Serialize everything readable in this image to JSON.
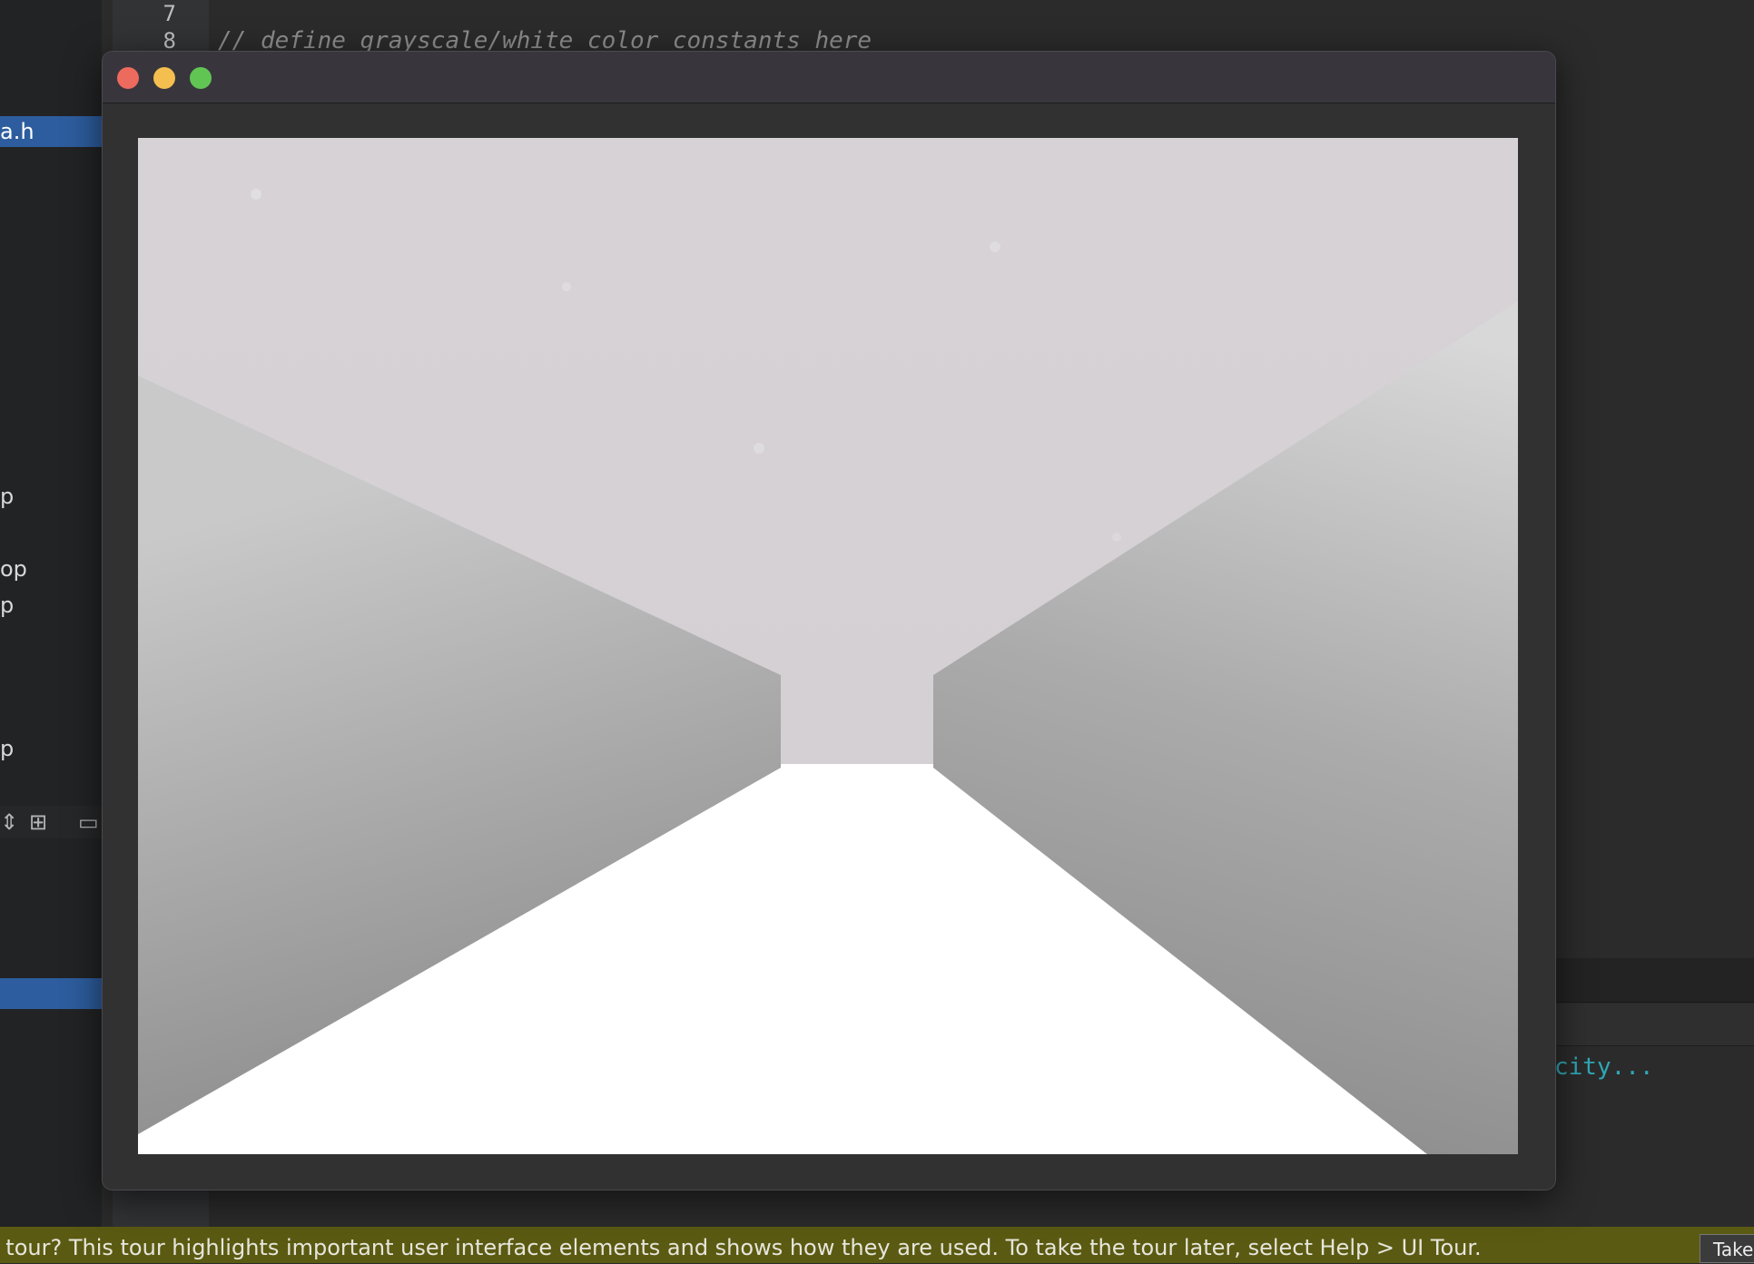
{
  "ide": {
    "sidebar_items": [
      {
        "label": "a.h",
        "selected": true
      },
      {
        "label": "p"
      },
      {
        "label": "op"
      },
      {
        "label": "p"
      },
      {
        "label": "p"
      }
    ],
    "line_numbers": [
      "7",
      "8"
    ],
    "code_line_8": "// define grayscale/white color constants here",
    "output_text": "city..."
  },
  "window": {
    "buttons": {
      "close": "close",
      "minimize": "minimize",
      "maximize": "maximize"
    }
  },
  "scene": {
    "ceiling_color": "#d4d0d4",
    "floor_color": "#ffffff",
    "wall_light": "#c8c8c8",
    "wall_dark": "#8a8a8a"
  },
  "tour_banner": {
    "message": "l tour? This tour highlights important user interface elements and shows how they are used. To take the tour later, select Help > UI Tour.",
    "button_label": "Take"
  }
}
